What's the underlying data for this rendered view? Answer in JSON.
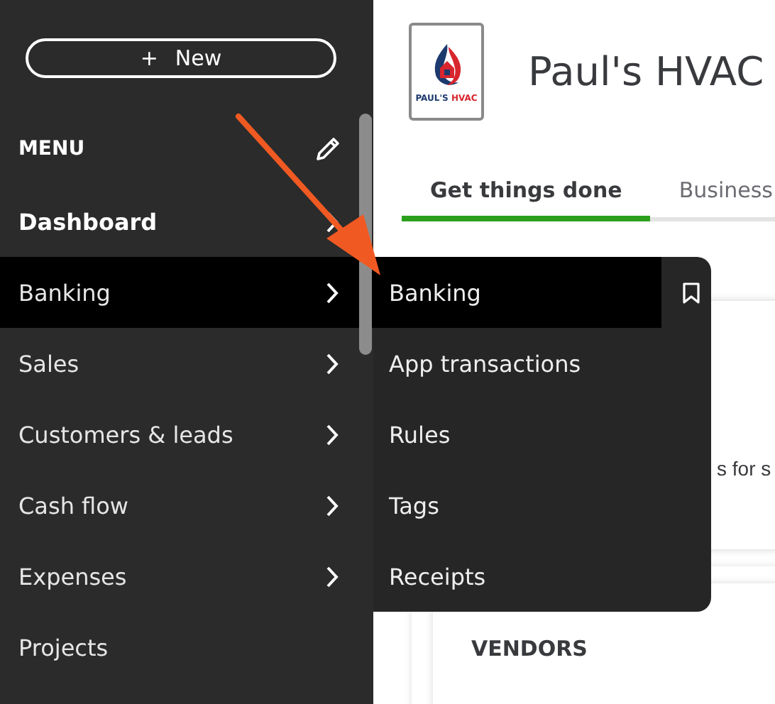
{
  "sidebar": {
    "new_button": {
      "icon": "+",
      "label": "New"
    },
    "menu_heading": "MENU",
    "items": [
      {
        "label": "Dashboard",
        "bold": true,
        "expandable": true,
        "selected": false
      },
      {
        "label": "Banking",
        "bold": false,
        "expandable": true,
        "selected": true
      },
      {
        "label": "Sales",
        "bold": false,
        "expandable": true,
        "selected": false
      },
      {
        "label": "Customers & leads",
        "bold": false,
        "expandable": true,
        "selected": false
      },
      {
        "label": "Cash flow",
        "bold": false,
        "expandable": true,
        "selected": false
      },
      {
        "label": "Expenses",
        "bold": false,
        "expandable": true,
        "selected": false
      },
      {
        "label": "Projects",
        "bold": false,
        "expandable": false,
        "selected": false
      }
    ]
  },
  "flyout": {
    "items": [
      {
        "label": "Banking",
        "selected": true
      },
      {
        "label": "App transactions",
        "selected": false
      },
      {
        "label": "Rules",
        "selected": false
      },
      {
        "label": "Tags",
        "selected": false
      },
      {
        "label": "Receipts",
        "selected": false
      }
    ]
  },
  "header": {
    "logo": {
      "name": "PAUL'S",
      "accent": "HVAC"
    },
    "company": "Paul's HVAC"
  },
  "tabs": [
    {
      "label": "Get things done",
      "selected": true
    },
    {
      "label": "Business",
      "selected": false
    }
  ],
  "cards": [
    {
      "text": "s for s"
    },
    {
      "title": "VENDORS"
    }
  ]
}
